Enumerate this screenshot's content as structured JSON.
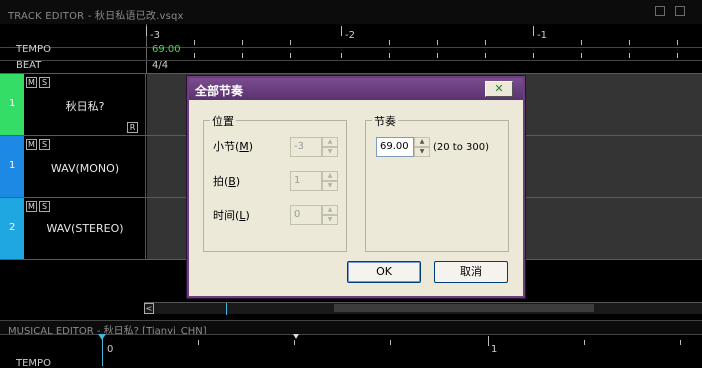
{
  "track_editor": {
    "title": "TRACK EDITOR - 秋日私语已改.vsqx",
    "tempo_label": "TEMPO",
    "beat_label": "BEAT",
    "tempo_value": "69.00",
    "beat_value": "4/4",
    "measures": [
      "-3",
      "-2",
      "-1"
    ],
    "tracks": [
      {
        "number": "1",
        "name": "秋日私?",
        "color": "#33dd66",
        "mute": "M",
        "solo": "S",
        "r": "R"
      },
      {
        "number": "1",
        "name": "WAV(MONO)",
        "color": "#1e88e5",
        "mute": "M",
        "solo": "S"
      },
      {
        "number": "2",
        "name": "WAV(STEREO)",
        "color": "#1ea7e0",
        "mute": "M",
        "solo": "S"
      }
    ]
  },
  "musical_editor": {
    "title": "MUSICAL EDITOR - 秋日私? [Tianyi_CHN]",
    "measures": [
      "0",
      "1"
    ],
    "tempo_label": "TEMPO"
  },
  "dialog": {
    "title": "全部节奏",
    "close_icon": "close-x-icon",
    "position_group": "位置",
    "measure_label": "小节(",
    "measure_key": "M",
    "measure_value": "-3",
    "beat_label": "拍(",
    "beat_key": "B",
    "beat_value": "1",
    "time_label": "时间(",
    "time_key": "L",
    "time_value": "0",
    "tempo_group": "节奏",
    "tempo_value": "69.00",
    "tempo_range": "(20 to 300)",
    "ok_label": "OK",
    "cancel_label": "取消"
  },
  "scrollbar": {
    "left_arrow": "<"
  }
}
